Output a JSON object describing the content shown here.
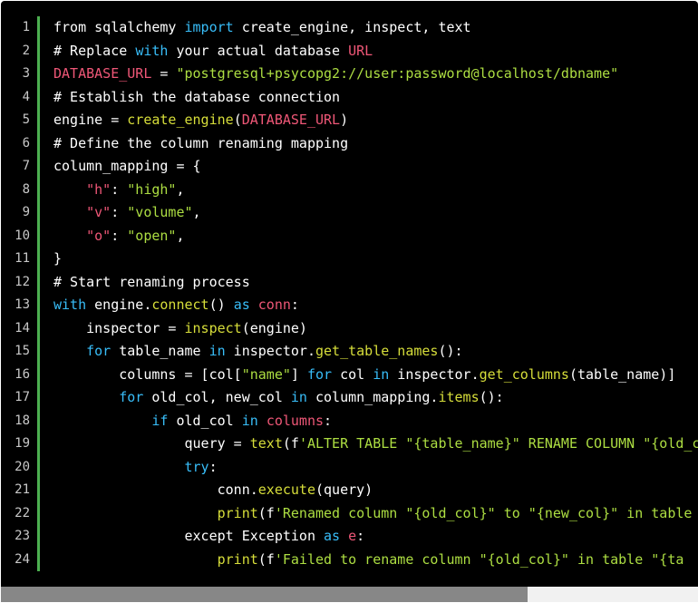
{
  "editor": {
    "line_numbers": [
      "1",
      "2",
      "3",
      "4",
      "5",
      "6",
      "7",
      "8",
      "9",
      "10",
      "11",
      "12",
      "13",
      "14",
      "15",
      "16",
      "17",
      "18",
      "19",
      "20",
      "21",
      "22",
      "23",
      "24"
    ],
    "colors": {
      "background": "#000000",
      "gutter_border": "#4CAF50",
      "keyword": "#38bdf8",
      "string": "#adde42",
      "constant": "#ef5777",
      "function": "#d7de3a",
      "default": "#ffffff"
    },
    "lines": [
      [
        {
          "t": "default",
          "v": "from sqlalchemy "
        },
        {
          "t": "keyword",
          "v": "import"
        },
        {
          "t": "default",
          "v": " create_engine, inspect, text"
        }
      ],
      [
        {
          "t": "comment",
          "v": "# Replace "
        },
        {
          "t": "keyword",
          "v": "with"
        },
        {
          "t": "comment",
          "v": " your actual database "
        },
        {
          "t": "const",
          "v": "URL"
        }
      ],
      [
        {
          "t": "const",
          "v": "DATABASE_URL"
        },
        {
          "t": "default",
          "v": " = "
        },
        {
          "t": "string",
          "v": "\"postgresql+psycopg2://user:password@localhost/dbname\""
        }
      ],
      [
        {
          "t": "comment",
          "v": "# Establish the database connection"
        }
      ],
      [
        {
          "t": "default",
          "v": "engine = "
        },
        {
          "t": "func",
          "v": "create_engine"
        },
        {
          "t": "default",
          "v": "("
        },
        {
          "t": "const",
          "v": "DATABASE_URL"
        },
        {
          "t": "default",
          "v": ")"
        }
      ],
      [
        {
          "t": "comment",
          "v": "# Define the column renaming mapping"
        }
      ],
      [
        {
          "t": "default",
          "v": "column_mapping = {"
        }
      ],
      [
        {
          "t": "default",
          "v": "    "
        },
        {
          "t": "const",
          "v": "\"h\""
        },
        {
          "t": "default",
          "v": ": "
        },
        {
          "t": "string",
          "v": "\"high\""
        },
        {
          "t": "default",
          "v": ","
        }
      ],
      [
        {
          "t": "default",
          "v": "    "
        },
        {
          "t": "const",
          "v": "\"v\""
        },
        {
          "t": "default",
          "v": ": "
        },
        {
          "t": "string",
          "v": "\"volume\""
        },
        {
          "t": "default",
          "v": ","
        }
      ],
      [
        {
          "t": "default",
          "v": "    "
        },
        {
          "t": "const",
          "v": "\"o\""
        },
        {
          "t": "default",
          "v": ": "
        },
        {
          "t": "string",
          "v": "\"open\""
        },
        {
          "t": "default",
          "v": ","
        }
      ],
      [
        {
          "t": "default",
          "v": "}"
        }
      ],
      [
        {
          "t": "comment",
          "v": "# Start renaming process"
        }
      ],
      [
        {
          "t": "keyword",
          "v": "with"
        },
        {
          "t": "default",
          "v": " engine."
        },
        {
          "t": "func",
          "v": "connect"
        },
        {
          "t": "default",
          "v": "() "
        },
        {
          "t": "keyword",
          "v": "as"
        },
        {
          "t": "default",
          "v": " "
        },
        {
          "t": "const",
          "v": "conn"
        },
        {
          "t": "default",
          "v": ":"
        }
      ],
      [
        {
          "t": "default",
          "v": "    inspector = "
        },
        {
          "t": "func",
          "v": "inspect"
        },
        {
          "t": "default",
          "v": "(engine)"
        }
      ],
      [
        {
          "t": "default",
          "v": "    "
        },
        {
          "t": "keyword",
          "v": "for"
        },
        {
          "t": "default",
          "v": " table_name "
        },
        {
          "t": "keyword",
          "v": "in"
        },
        {
          "t": "default",
          "v": " inspector."
        },
        {
          "t": "func",
          "v": "get_table_names"
        },
        {
          "t": "default",
          "v": "():"
        }
      ],
      [
        {
          "t": "default",
          "v": "        columns = [col["
        },
        {
          "t": "string",
          "v": "\"name\""
        },
        {
          "t": "default",
          "v": "] "
        },
        {
          "t": "keyword",
          "v": "for"
        },
        {
          "t": "default",
          "v": " col "
        },
        {
          "t": "keyword",
          "v": "in"
        },
        {
          "t": "default",
          "v": " inspector."
        },
        {
          "t": "func",
          "v": "get_columns"
        },
        {
          "t": "default",
          "v": "(table_name)]"
        }
      ],
      [
        {
          "t": "default",
          "v": "        "
        },
        {
          "t": "keyword",
          "v": "for"
        },
        {
          "t": "default",
          "v": " old_col, new_col "
        },
        {
          "t": "keyword",
          "v": "in"
        },
        {
          "t": "default",
          "v": " column_mapping."
        },
        {
          "t": "func",
          "v": "items"
        },
        {
          "t": "default",
          "v": "():"
        }
      ],
      [
        {
          "t": "default",
          "v": "            "
        },
        {
          "t": "keyword",
          "v": "if"
        },
        {
          "t": "default",
          "v": " old_col "
        },
        {
          "t": "keyword",
          "v": "in"
        },
        {
          "t": "default",
          "v": " "
        },
        {
          "t": "const",
          "v": "columns"
        },
        {
          "t": "default",
          "v": ":"
        }
      ],
      [
        {
          "t": "default",
          "v": "                query = "
        },
        {
          "t": "func",
          "v": "text"
        },
        {
          "t": "default",
          "v": "(f"
        },
        {
          "t": "string",
          "v": "'ALTER TABLE \"{table_name}\" RENAME COLUMN \"{old_col}\""
        }
      ],
      [
        {
          "t": "default",
          "v": "                "
        },
        {
          "t": "keyword",
          "v": "try"
        },
        {
          "t": "default",
          "v": ":"
        }
      ],
      [
        {
          "t": "default",
          "v": "                    conn."
        },
        {
          "t": "func",
          "v": "execute"
        },
        {
          "t": "default",
          "v": "(query)"
        }
      ],
      [
        {
          "t": "default",
          "v": "                    "
        },
        {
          "t": "func",
          "v": "print"
        },
        {
          "t": "default",
          "v": "(f"
        },
        {
          "t": "string",
          "v": "'Renamed column \"{old_col}\" to \"{new_col}\" in table"
        }
      ],
      [
        {
          "t": "default",
          "v": "                except Exception "
        },
        {
          "t": "keyword",
          "v": "as"
        },
        {
          "t": "default",
          "v": " "
        },
        {
          "t": "const",
          "v": "e"
        },
        {
          "t": "default",
          "v": ":"
        }
      ],
      [
        {
          "t": "default",
          "v": "                    "
        },
        {
          "t": "func",
          "v": "print"
        },
        {
          "t": "default",
          "v": "(f"
        },
        {
          "t": "string",
          "v": "'Failed to rename column \"{old_col}\" in table \"{ta"
        }
      ]
    ]
  },
  "scrollbar": {
    "thumb_fraction": 0.755
  }
}
